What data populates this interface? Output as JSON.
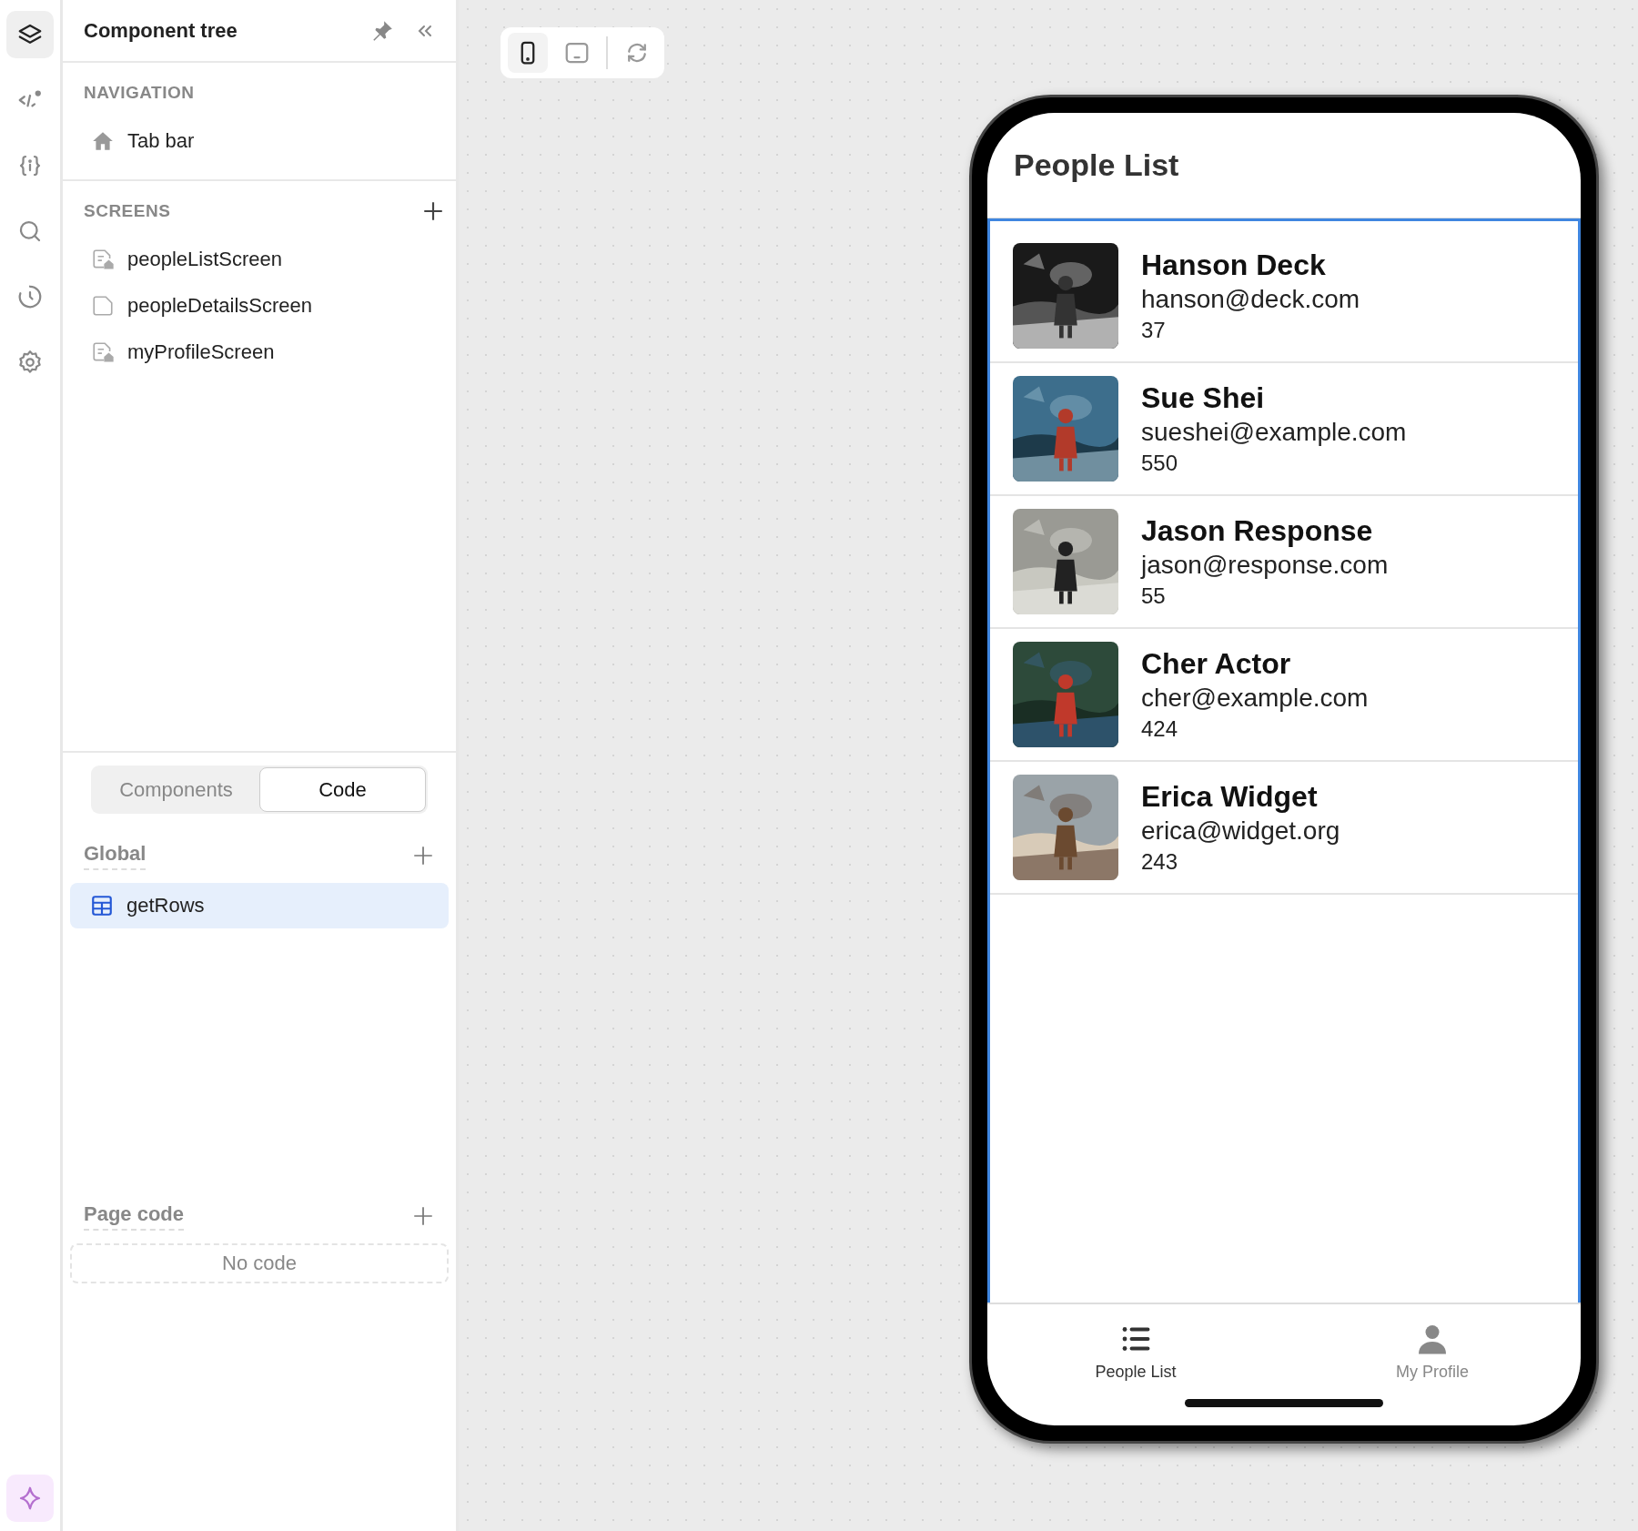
{
  "rail": [
    {
      "kind": "layers",
      "selected": true
    },
    {
      "kind": "code",
      "selected": false
    },
    {
      "kind": "variables",
      "selected": false
    },
    {
      "kind": "search",
      "selected": false
    },
    {
      "kind": "history",
      "selected": false
    },
    {
      "kind": "settings",
      "selected": false
    },
    {
      "kind": "ai",
      "selected": false
    }
  ],
  "panel": {
    "title": "Component tree",
    "navigation": {
      "heading": "NAVIGATION",
      "items": [
        {
          "label": "Tab bar",
          "kind": "home"
        }
      ]
    },
    "screens": {
      "heading": "SCREENS",
      "items": [
        {
          "label": "peopleListScreen",
          "kind": "home-screen"
        },
        {
          "label": "peopleDetailsScreen",
          "kind": "screen"
        },
        {
          "label": "myProfileScreen",
          "kind": "home-screen"
        }
      ]
    },
    "tabs": [
      {
        "label": "Components",
        "selected": false
      },
      {
        "label": "Code",
        "selected": true
      }
    ],
    "global": {
      "heading": "Global",
      "items": [
        {
          "label": "getRows",
          "selected": true
        }
      ]
    },
    "page_code": {
      "heading": "Page code",
      "empty": "No code"
    }
  },
  "toolbar": [
    {
      "kind": "portrait",
      "selected": true
    },
    {
      "kind": "landscape",
      "selected": false
    },
    {
      "kind": "rotate",
      "selected": false
    }
  ],
  "phone": {
    "title": "People List",
    "people": [
      {
        "name": "Hanson Deck",
        "email": "hanson@deck.com",
        "number": "37"
      },
      {
        "name": "Sue Shei",
        "email": "sueshei@example.com",
        "number": "550"
      },
      {
        "name": "Jason Response",
        "email": "jason@response.com",
        "number": "55"
      },
      {
        "name": "Cher Actor",
        "email": "cher@example.com",
        "number": "424"
      },
      {
        "name": "Erica Widget",
        "email": "erica@widget.org",
        "number": "243"
      }
    ],
    "tabs": [
      {
        "label": "People List",
        "kind": "list",
        "selected": true
      },
      {
        "label": "My Profile",
        "kind": "person",
        "selected": false
      }
    ]
  }
}
